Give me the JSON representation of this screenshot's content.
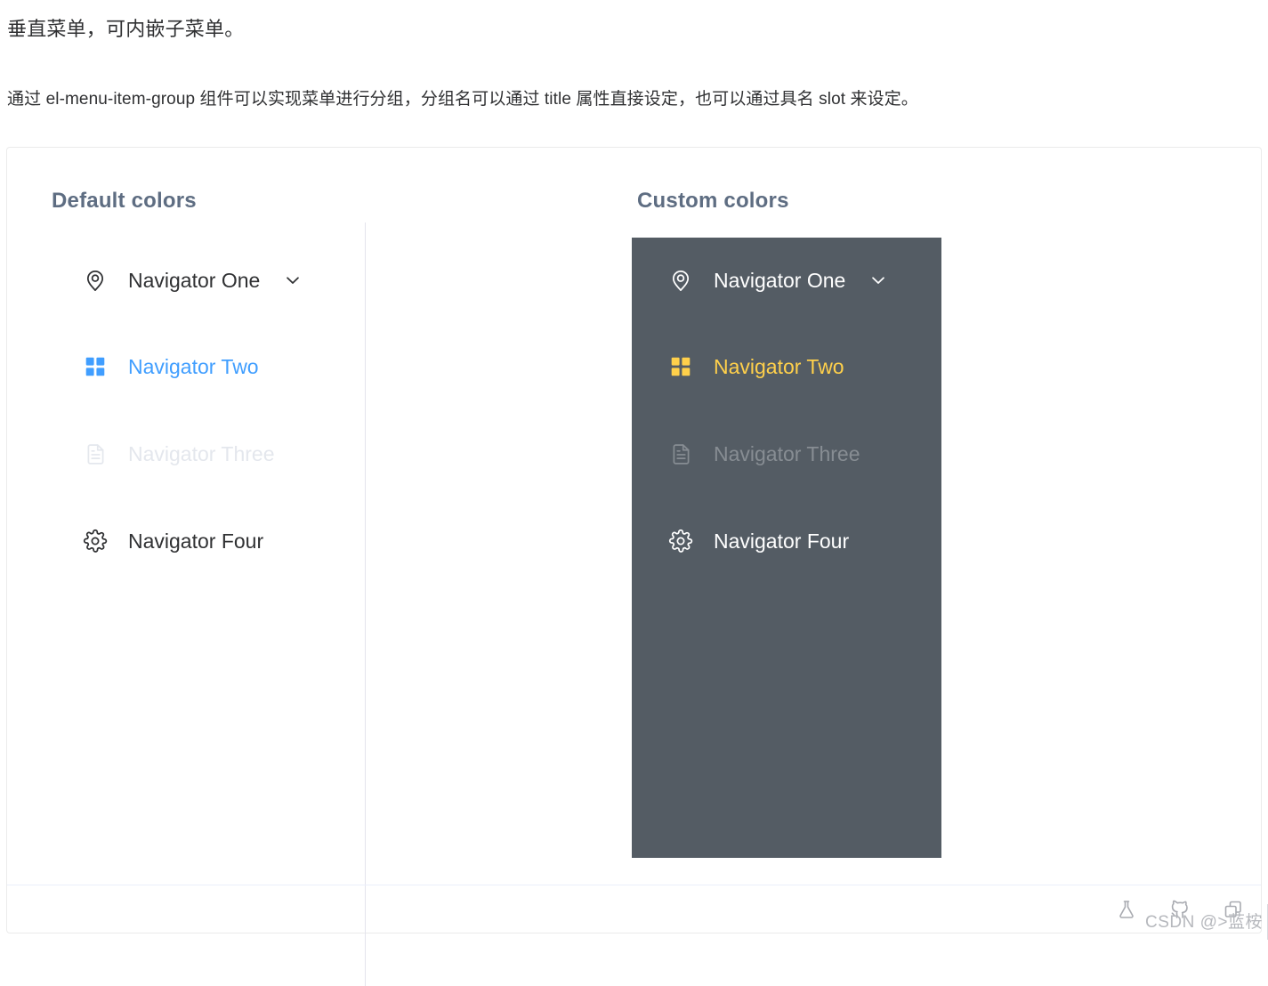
{
  "intro": {
    "title": "垂直菜单，可内嵌子菜单。",
    "description": "通过 el-menu-item-group 组件可以实现菜单进行分组，分组名可以通过 title 属性直接设定，也可以通过具名 slot 来设定。"
  },
  "colors": {
    "primary_blue": "#409eff",
    "dark_background": "#545c64",
    "dark_active_text": "#ffd04b",
    "dark_text": "#ffffff",
    "disabled_light": "#e4e7ed",
    "disabled_dark": "#878d93",
    "heading": "#5e6d82",
    "card_border": "#ebebeb",
    "divider": "#e4e4ec"
  },
  "sections": [
    {
      "id": "default-colors",
      "title": "Default colors",
      "theme": "light",
      "items": [
        {
          "label": "Navigator One",
          "icon": "location-pin-icon",
          "state": "normal",
          "has_arrow": true
        },
        {
          "label": "Navigator Two",
          "icon": "grid-icon",
          "state": "active",
          "has_arrow": false
        },
        {
          "label": "Navigator Three",
          "icon": "document-icon",
          "state": "disabled",
          "has_arrow": false
        },
        {
          "label": "Navigator Four",
          "icon": "gear-icon",
          "state": "normal",
          "has_arrow": false
        }
      ]
    },
    {
      "id": "custom-colors",
      "title": "Custom colors",
      "theme": "dark",
      "items": [
        {
          "label": "Navigator One",
          "icon": "location-pin-icon",
          "state": "normal",
          "has_arrow": true
        },
        {
          "label": "Navigator Two",
          "icon": "grid-icon",
          "state": "active",
          "has_arrow": false
        },
        {
          "label": "Navigator Three",
          "icon": "document-icon",
          "state": "disabled",
          "has_arrow": false
        },
        {
          "label": "Navigator Four",
          "icon": "gear-icon",
          "state": "normal",
          "has_arrow": false
        }
      ]
    }
  ],
  "footer": {
    "icons": [
      "flask-icon",
      "github-icon",
      "copy-icon"
    ]
  },
  "watermark": {
    "text": "CSDN @>蓝桉"
  }
}
